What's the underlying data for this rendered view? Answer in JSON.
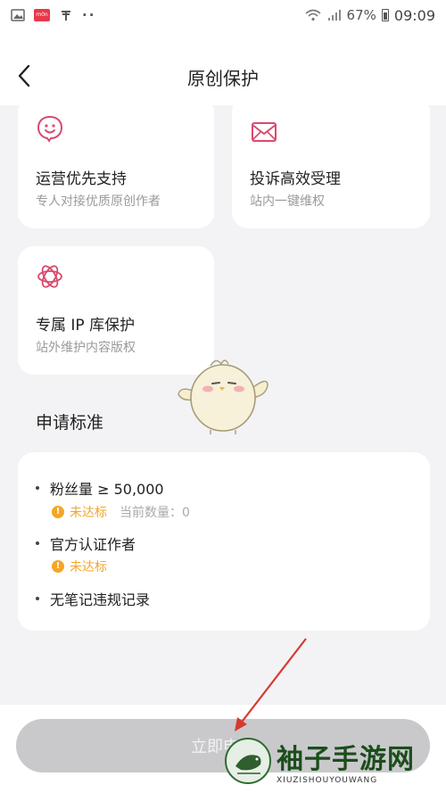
{
  "status_bar": {
    "battery": "67%",
    "time": "09:09",
    "red_icon_text": "m0n"
  },
  "header": {
    "title": "原创保护"
  },
  "benefits": [
    {
      "title": "运营优先支持",
      "subtitle": "专人对接优质原创作者",
      "icon": "smile-badge-icon"
    },
    {
      "title": "投诉高效受理",
      "subtitle": "站内一键维权",
      "icon": "envelope-icon"
    },
    {
      "title": "专属 IP 库保护",
      "subtitle": "站外维护内容版权",
      "icon": "flower-icon"
    }
  ],
  "requirements": {
    "section_title": "申请标准",
    "items": [
      {
        "text": "粉丝量 ≥ 50,000",
        "status": "未达标",
        "count": "当前数量：0"
      },
      {
        "text": "官方认证作者",
        "status": "未达标"
      },
      {
        "text": "无笔记违规记录"
      }
    ]
  },
  "footer": {
    "apply_label": "立即申请"
  },
  "watermark": {
    "cn": "袖子手游网",
    "en": "XIUZISHOUYOUWANG"
  },
  "colors": {
    "accent_pink": "#d94a6e",
    "warning": "#f5a623",
    "button_disabled": "#c9c9cc",
    "background": "#f3f3f6"
  }
}
